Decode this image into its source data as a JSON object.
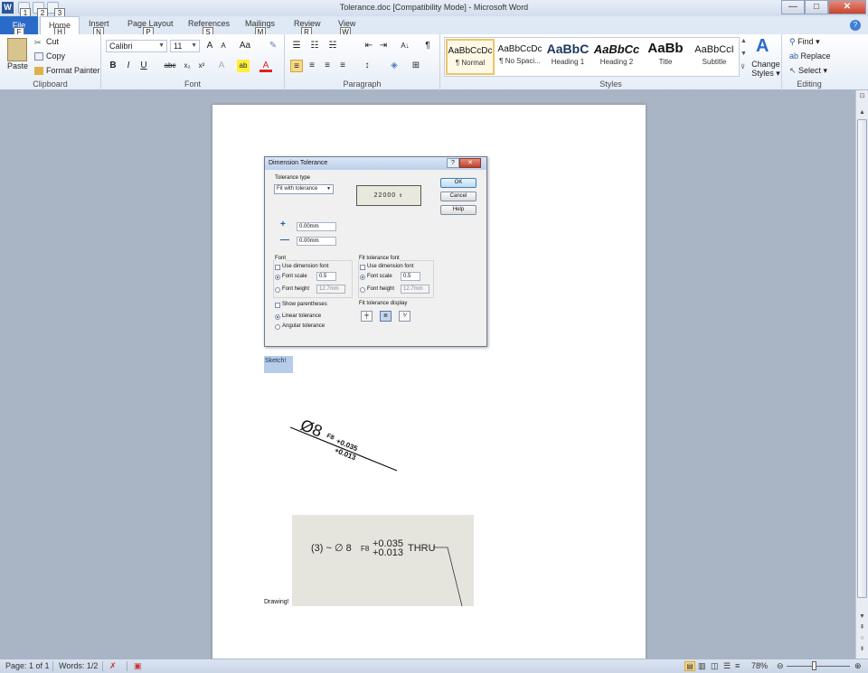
{
  "window": {
    "title": "Tolerance.doc [Compatibility Mode] - Microsoft Word",
    "app_icon": "W",
    "qat_keytips": [
      "1",
      "2",
      "3"
    ],
    "controls": {
      "minimize": "—",
      "maximize": "□",
      "close": "✕"
    }
  },
  "tabs": [
    {
      "label": "File",
      "keytip": "F"
    },
    {
      "label": "Home",
      "keytip": "H"
    },
    {
      "label": "Insert",
      "keytip": "N"
    },
    {
      "label": "Page Layout",
      "keytip": "P"
    },
    {
      "label": "References",
      "keytip": "S"
    },
    {
      "label": "Mailings",
      "keytip": "M"
    },
    {
      "label": "Review",
      "keytip": "R"
    },
    {
      "label": "View",
      "keytip": "W"
    }
  ],
  "ribbon": {
    "clipboard": {
      "label": "Clipboard",
      "paste": "Paste",
      "cut": "Cut",
      "copy": "Copy",
      "format_painter": "Format Painter"
    },
    "font": {
      "label": "Font",
      "font_name": "Calibri",
      "font_size": "11"
    },
    "paragraph": {
      "label": "Paragraph"
    },
    "styles": {
      "label": "Styles",
      "items": [
        {
          "sample": "AaBbCcDc",
          "name": "¶ Normal"
        },
        {
          "sample": "AaBbCcDc",
          "name": "¶ No Spaci..."
        },
        {
          "sample": "AaBbC",
          "name": "Heading 1"
        },
        {
          "sample": "AaBbCc",
          "name": "Heading 2"
        },
        {
          "sample": "AaBb",
          "name": "Title"
        },
        {
          "sample": "AaBbCcI",
          "name": "Subtitle"
        }
      ],
      "change_styles": "Change Styles ▾"
    },
    "editing": {
      "label": "Editing",
      "find": "Find ▾",
      "replace": "Replace",
      "select": "Select ▾"
    }
  },
  "dialog": {
    "title": "Dimension Tolerance",
    "tolerance_type_label": "Tolerance type",
    "tolerance_type_value": "Fit with tolerance",
    "preview_value": "22000",
    "ok": "OK",
    "cancel": "Cancel",
    "help": "Help",
    "plus_value": "0.00mm",
    "minus_value": "0.00mm",
    "font_group": "Font",
    "fit_font_group": "Fit tolerance font",
    "use_dimension_font": "Use dimension font",
    "font_scale": "Font scale",
    "font_height": "Font height",
    "scale_value": "0.5",
    "height_value": "12.7mm",
    "show_parentheses": "Show parentheses",
    "linear_tolerance": "Linear tolerance",
    "angular_tolerance": "Angular tolerance",
    "fit_display_label": "Fit tolerance display"
  },
  "document": {
    "sketch_label": "Sketch!",
    "sketch_dimension": {
      "diameter": "Ø8",
      "fit": "F8",
      "upper": "+0.035",
      "lower": "+0.013"
    },
    "drawing_callout": {
      "prefix": "(3) ~ ∅ 8",
      "fit": "F8",
      "upper": "+0.035",
      "lower": "+0.013",
      "suffix": "THRU"
    },
    "drawing_label": "Drawing!"
  },
  "status": {
    "page": "Page: 1 of 1",
    "words": "Words: 1/2",
    "zoom": "78%"
  }
}
